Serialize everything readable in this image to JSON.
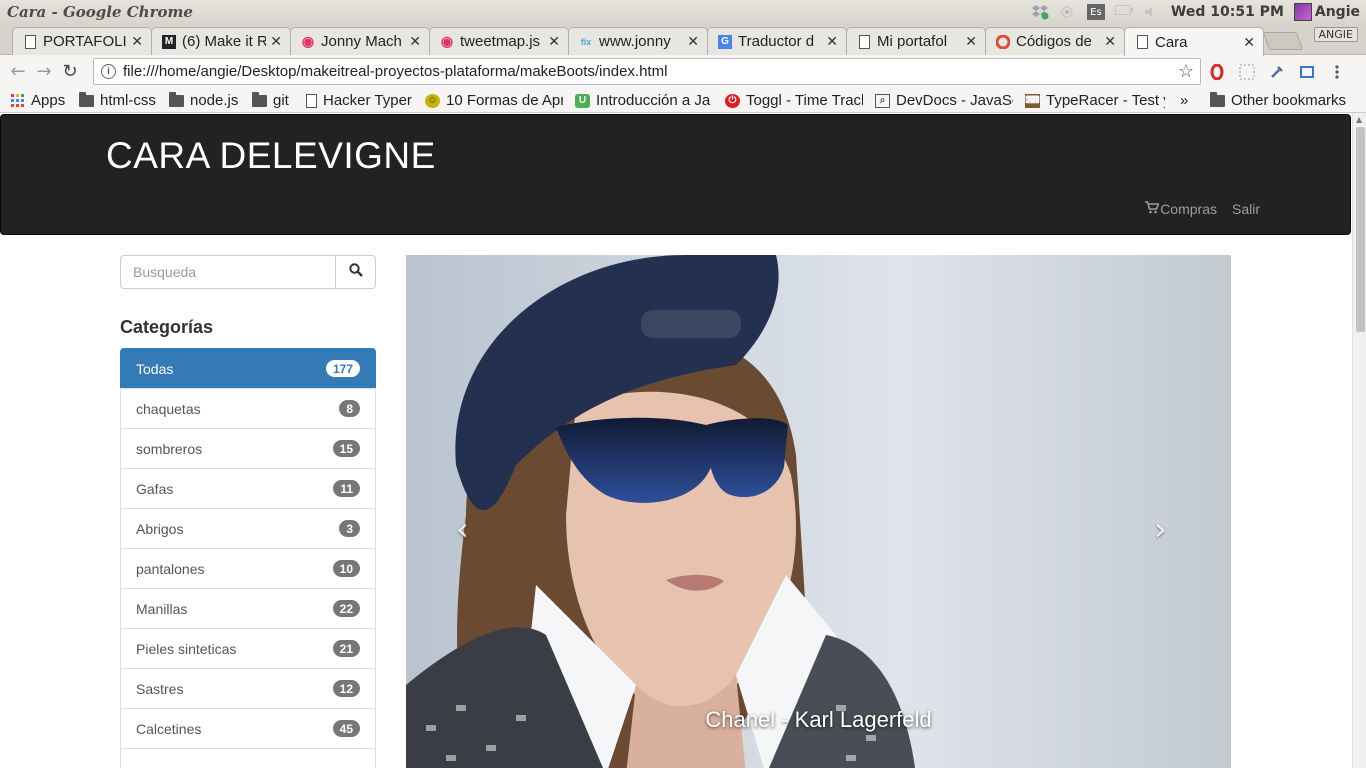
{
  "os": {
    "window_title": "Cara - Google Chrome",
    "lang": "Es",
    "clock": "Wed 10:51 PM",
    "user": "Angie"
  },
  "tabs": [
    {
      "title": "PORTAFOLI",
      "favicon": "page-icon"
    },
    {
      "title": "(6) Make it R",
      "favicon": "makeitreal-icon"
    },
    {
      "title": "Jonny Mach",
      "favicon": "swirl-icon"
    },
    {
      "title": "tweetmap.js",
      "favicon": "swirl-icon"
    },
    {
      "title": "www.jonny",
      "favicon": "fix-icon"
    },
    {
      "title": "Traductor d",
      "favicon": "translate-icon"
    },
    {
      "title": "Mi portafol",
      "favicon": "page-icon"
    },
    {
      "title": "Códigos de",
      "favicon": "opera-icon"
    },
    {
      "title": "Cara",
      "favicon": "page-icon",
      "active": true
    }
  ],
  "profile_badge": "ANGIE",
  "omnibox": {
    "url": "file:///home/angie/Desktop/makeitreal-proyectos-plataforma/makeBoots/index.html"
  },
  "bookmarks": {
    "items": [
      {
        "label": "Apps",
        "icon": "apps-icon"
      },
      {
        "label": "html-css",
        "icon": "folder-icon"
      },
      {
        "label": "node.js",
        "icon": "folder-icon"
      },
      {
        "label": "git",
        "icon": "folder-icon"
      },
      {
        "label": "Hacker Typer",
        "icon": "page-icon"
      },
      {
        "label": "10 Formas de Apr",
        "icon": "smiley-icon"
      },
      {
        "label": "Introducción a Ja",
        "icon": "udemy-icon"
      },
      {
        "label": "Toggl - Time Track",
        "icon": "toggl-icon"
      },
      {
        "label": "DevDocs - JavaSc",
        "icon": "devdocs-icon"
      },
      {
        "label": "TypeRacer - Test y",
        "icon": "typeracer-icon"
      }
    ],
    "overflow": "»",
    "other": "Other bookmarks"
  },
  "site": {
    "brand": "CARA DELEVIGNE",
    "nav": {
      "cart": "Compras",
      "logout": "Salir"
    },
    "search": {
      "placeholder": "Busqueda"
    },
    "categories_heading": "Categorías",
    "categories": [
      {
        "name": "Todas",
        "count": "177",
        "active": true
      },
      {
        "name": "chaquetas",
        "count": "8"
      },
      {
        "name": "sombreros",
        "count": "15"
      },
      {
        "name": "Gafas",
        "count": "11"
      },
      {
        "name": "Abrigos",
        "count": "3"
      },
      {
        "name": "pantalones",
        "count": "10"
      },
      {
        "name": "Manillas",
        "count": "22"
      },
      {
        "name": "Pieles sinteticas",
        "count": "21"
      },
      {
        "name": "Sastres",
        "count": "12"
      },
      {
        "name": "Calcetines",
        "count": "45"
      }
    ],
    "carousel": {
      "caption": "Chanel - Karl Lagerfeld",
      "prev": "‹",
      "next": "›"
    }
  },
  "colors": {
    "navbar": "#222222",
    "active_category": "#337ab7",
    "badge": "#777777"
  }
}
